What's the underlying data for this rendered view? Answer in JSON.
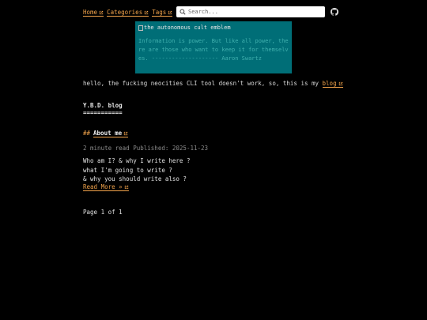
{
  "nav": {
    "home_label": "Home",
    "categories_label": "Categories",
    "tags_label": "Tags"
  },
  "search": {
    "placeholder": "Search..."
  },
  "icons": {
    "external_link": "external-link-icon",
    "search": "search-icon",
    "github": "github-icon"
  },
  "colors": {
    "accent": "#f0a24a",
    "banner_bg": "#006e77",
    "quote_text": "#3fb0ae",
    "background": "#000000"
  },
  "banner": {
    "image_alt": "the autonomous cult emblem",
    "quote": "Information is power. But like all power, there are those who want to keep it for themselves. --------------------",
    "author": "Aaron Swartz"
  },
  "intro": {
    "text": "hello, the fucking neocities CLI tool doesn't work, so, this is my ",
    "link_label": "blog"
  },
  "blog_heading": {
    "title": "Y.B.D. blog",
    "underline": "==========="
  },
  "post": {
    "hash": "##",
    "title": "About me",
    "meta": "2 minute read Published: 2025-11-23",
    "excerpt": [
      "Who am I? & why I write here ?",
      "what I'm going to write ?",
      "& why you should write also ?"
    ],
    "read_more": "Read More »"
  },
  "pagination": {
    "text": "Page 1 of 1"
  }
}
